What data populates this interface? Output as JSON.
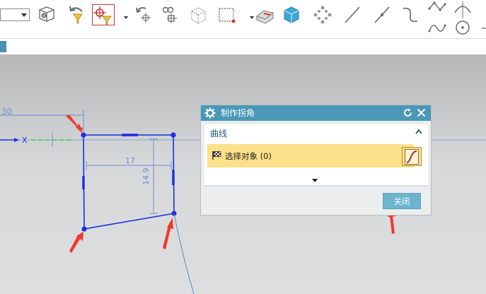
{
  "toolbar": {
    "icons": [
      "sketch-filter-icon",
      "cube-transform-icon",
      "undo-arrow-filter-icon",
      "snap-point-filter-icon",
      "rotate-point-icon",
      "constraint-icon",
      "wireframe-box-icon",
      "rectangle-select-icon",
      "eraser-shape-icon",
      "box-cube-icon",
      "move-nodes-icon",
      "line-icon",
      "line-with-points-icon",
      "curve-icon",
      "spline-icon",
      "arc-icon",
      "circle-center-icon",
      "cross-icon"
    ],
    "colors": {
      "accent_red": "#d63a2a",
      "filter_yellow": "#f2c43a",
      "icon_gray": "#6a6a6a",
      "blue_cube": "#3fa7d8"
    }
  },
  "sketch": {
    "dimensions": {
      "d30": "30",
      "d17": "17",
      "d149": "14.9"
    },
    "axis_label": "X",
    "colors": {
      "line": "#1b2ee0",
      "dim": "#6f8ed6",
      "green": "#2fd22f",
      "arrow": "#f03a2a"
    }
  },
  "dialog": {
    "title": "制作拐角",
    "section_title": "曲线",
    "select_label": "选择对象 (0)",
    "close_button": "关闭",
    "colors": {
      "title_bar": "#4a98b6",
      "select_bg": "#fce08a",
      "button": "#6db4cf"
    }
  }
}
